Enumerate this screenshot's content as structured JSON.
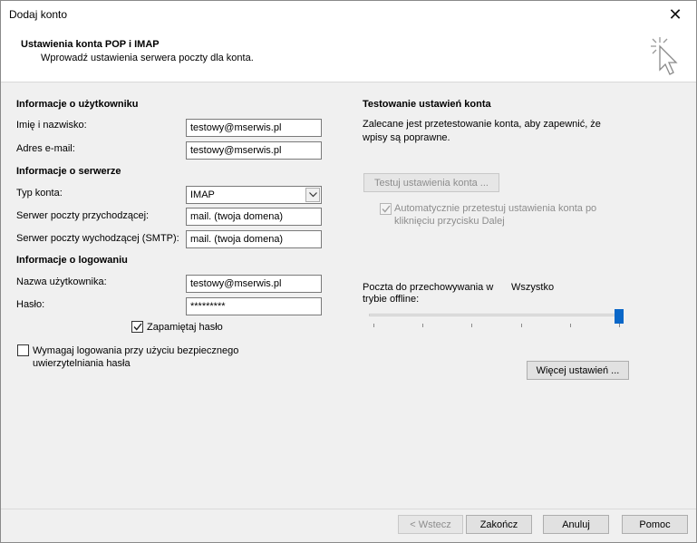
{
  "window": {
    "title": "Dodaj konto",
    "close_glyph": "✕"
  },
  "header": {
    "title": "Ustawienia konta POP i IMAP",
    "subtitle": "Wprowadź ustawienia serwera poczty dla konta.",
    "icon": "cursor-click-icon"
  },
  "user_info": {
    "section_title": "Informacje o użytkowniku",
    "name_label": "Imię i nazwisko:",
    "name_value": "testowy@mserwis.pl",
    "email_label": "Adres e-mail:",
    "email_value": "testowy@mserwis.pl"
  },
  "server_info": {
    "section_title": "Informacje o serwerze",
    "account_type_label": "Typ konta:",
    "account_type_value": "IMAP",
    "incoming_label": "Serwer poczty przychodzącej:",
    "incoming_value": "mail. (twoja domena)",
    "outgoing_label": "Serwer poczty wychodzącej (SMTP):",
    "outgoing_value": "mail. (twoja domena)"
  },
  "login_info": {
    "section_title": "Informacje o logowaniu",
    "username_label": "Nazwa użytkownika:",
    "username_value": "testowy@mserwis.pl",
    "password_label": "Hasło:",
    "password_value": "*********",
    "remember_label": "Zapamiętaj hasło",
    "remember_checked": true,
    "spa_label_line1": "Wymagaj logowania przy użyciu bezpiecznego",
    "spa_label_line2": "uwierzytelniania hasła",
    "spa_checked": false
  },
  "test_settings": {
    "section_title": "Testowanie ustawień konta",
    "description_line1": "Zalecane jest przetestowanie konta, aby zapewnić, że",
    "description_line2": "wpisy są poprawne.",
    "test_button": "Testuj ustawienia konta ...",
    "auto_test_line1": "Automatycznie przetestuj ustawienia konta po",
    "auto_test_line2": "kliknięciu przycisku Dalej",
    "auto_test_checked": true
  },
  "offline": {
    "label_line1": "Poczta do przechowywania w",
    "label_line2": "trybie offline:",
    "value": "Wszystko",
    "slider_level": 1.0
  },
  "more_settings_button": "Więcej ustawień ...",
  "footer": {
    "back": "< Wstecz",
    "finish": "Zakończ",
    "cancel": "Anuluj",
    "help": "Pomoc"
  },
  "colors": {
    "slider_thumb": "#0a67c8",
    "disabled_text": "#8d8d8d"
  }
}
